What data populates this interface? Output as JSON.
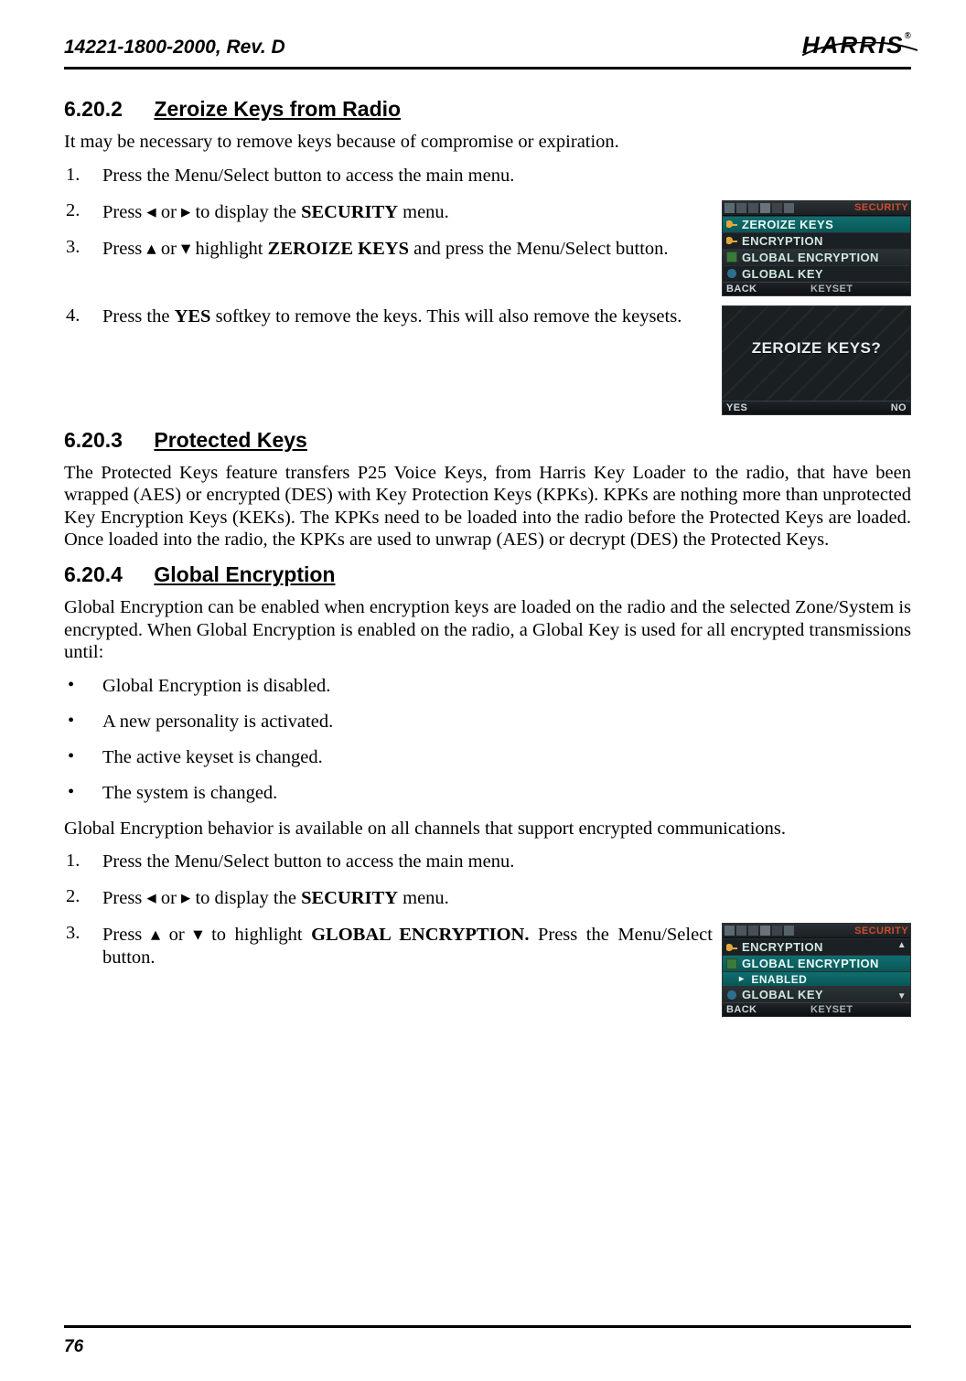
{
  "header": {
    "doc_id": "14221-1800-2000, Rev. D",
    "brand": "HARRIS",
    "reg": "®"
  },
  "footer": {
    "page": "76"
  },
  "sec_6_20_2": {
    "num": "6.20.2",
    "title": "Zeroize Keys from Radio",
    "intro": "It may be necessary to remove keys because of compromise or expiration.",
    "step1": {
      "n": "1.",
      "t": "Press the Menu/Select button to access the main menu."
    },
    "step2": {
      "n": "2.",
      "pre": "Press ",
      "mid": " or ",
      "post": " to display the ",
      "bold": "SECURITY",
      "end": " menu."
    },
    "step3": {
      "n": "3.",
      "pre": "Press ",
      "mid": " or ",
      "post": " highlight ",
      "bold": "ZEROIZE KEYS",
      "end": " and press the Menu/Select button."
    },
    "step4": {
      "n": "4.",
      "pre": "Press the ",
      "bold": "YES",
      "end": " softkey to remove the keys.  This will also remove the keysets."
    }
  },
  "sec_6_20_3": {
    "num": "6.20.3",
    "title": "Protected Keys",
    "para": "The Protected Keys feature transfers P25 Voice Keys, from Harris Key Loader to the radio, that have been wrapped (AES) or encrypted (DES) with Key Protection Keys (KPKs). KPKs are nothing more than unprotected Key Encryption Keys (KEKs). The KPKs need to be loaded into the radio before the Protected Keys are loaded. Once loaded into the radio, the KPKs are used to unwrap (AES) or decrypt (DES) the Protected Keys."
  },
  "sec_6_20_4": {
    "num": "6.20.4",
    "title": "Global Encryption",
    "para": "Global Encryption can be enabled when encryption keys are loaded on the radio and the selected Zone/System is encrypted. When Global Encryption is enabled on the radio, a Global Key is used for all encrypted transmissions until:",
    "b1": "Global Encryption is disabled.",
    "b2": "A new personality is activated.",
    "b3": "The active keyset is changed.",
    "b4": "The system is changed.",
    "para2": "Global Encryption behavior is available on all channels that support encrypted communications.",
    "step1": {
      "n": "1.",
      "t": "Press the Menu/Select button to access the main menu."
    },
    "step2": {
      "n": "2.",
      "pre": "Press ",
      "mid": " or ",
      "post": " to display the ",
      "bold": "SECURITY",
      "end": " menu."
    },
    "step3": {
      "n": "3.",
      "pre": "Press ",
      "mid": " or ",
      "post": " to highlight ",
      "bold": "GLOBAL ENCRYPTION.",
      "end": " Press the Menu/Select button."
    }
  },
  "screens": {
    "s1": {
      "status": "SECURITY",
      "rows": [
        "ZEROIZE KEYS",
        "ENCRYPTION",
        "GLOBAL ENCRYPTION",
        "GLOBAL KEY"
      ],
      "soft_left": "BACK",
      "soft_center": "KEYSET",
      "soft_right": ""
    },
    "s2": {
      "question": "ZEROIZE KEYS?",
      "soft_left": "YES",
      "soft_right": "NO"
    },
    "s3": {
      "status": "SECURITY",
      "rows": [
        "ENCRYPTION",
        "GLOBAL ENCRYPTION",
        "ENABLED",
        "GLOBAL KEY"
      ],
      "soft_left": "BACK",
      "soft_center": "KEYSET",
      "soft_right": ""
    }
  },
  "glyph": {
    "left": "◂",
    "right": "▸",
    "up": "▴",
    "down": "▾",
    "bullet": "•",
    "sub_arrow": "▸",
    "scroll_up": "▲",
    "scroll_down": "▼"
  }
}
